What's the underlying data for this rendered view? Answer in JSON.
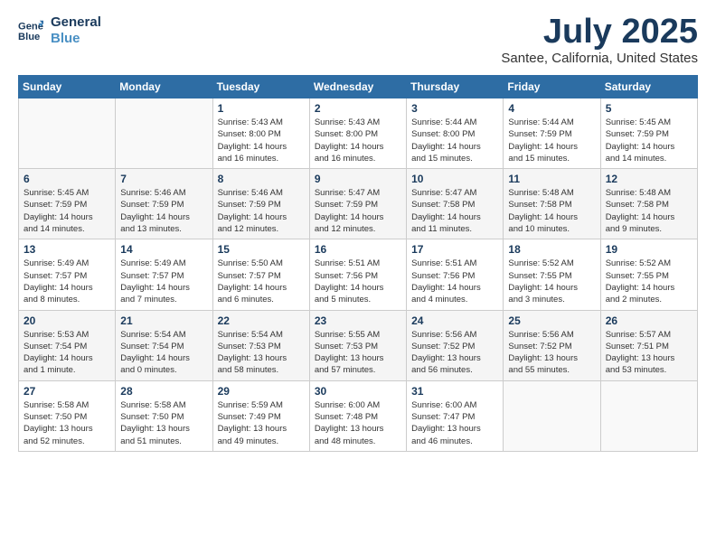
{
  "logo": {
    "line1": "General",
    "line2": "Blue"
  },
  "title": "July 2025",
  "location": "Santee, California, United States",
  "weekdays": [
    "Sunday",
    "Monday",
    "Tuesday",
    "Wednesday",
    "Thursday",
    "Friday",
    "Saturday"
  ],
  "weeks": [
    [
      {
        "day": "",
        "info": ""
      },
      {
        "day": "",
        "info": ""
      },
      {
        "day": "1",
        "info": "Sunrise: 5:43 AM\nSunset: 8:00 PM\nDaylight: 14 hours\nand 16 minutes."
      },
      {
        "day": "2",
        "info": "Sunrise: 5:43 AM\nSunset: 8:00 PM\nDaylight: 14 hours\nand 16 minutes."
      },
      {
        "day": "3",
        "info": "Sunrise: 5:44 AM\nSunset: 8:00 PM\nDaylight: 14 hours\nand 15 minutes."
      },
      {
        "day": "4",
        "info": "Sunrise: 5:44 AM\nSunset: 7:59 PM\nDaylight: 14 hours\nand 15 minutes."
      },
      {
        "day": "5",
        "info": "Sunrise: 5:45 AM\nSunset: 7:59 PM\nDaylight: 14 hours\nand 14 minutes."
      }
    ],
    [
      {
        "day": "6",
        "info": "Sunrise: 5:45 AM\nSunset: 7:59 PM\nDaylight: 14 hours\nand 14 minutes."
      },
      {
        "day": "7",
        "info": "Sunrise: 5:46 AM\nSunset: 7:59 PM\nDaylight: 14 hours\nand 13 minutes."
      },
      {
        "day": "8",
        "info": "Sunrise: 5:46 AM\nSunset: 7:59 PM\nDaylight: 14 hours\nand 12 minutes."
      },
      {
        "day": "9",
        "info": "Sunrise: 5:47 AM\nSunset: 7:59 PM\nDaylight: 14 hours\nand 12 minutes."
      },
      {
        "day": "10",
        "info": "Sunrise: 5:47 AM\nSunset: 7:58 PM\nDaylight: 14 hours\nand 11 minutes."
      },
      {
        "day": "11",
        "info": "Sunrise: 5:48 AM\nSunset: 7:58 PM\nDaylight: 14 hours\nand 10 minutes."
      },
      {
        "day": "12",
        "info": "Sunrise: 5:48 AM\nSunset: 7:58 PM\nDaylight: 14 hours\nand 9 minutes."
      }
    ],
    [
      {
        "day": "13",
        "info": "Sunrise: 5:49 AM\nSunset: 7:57 PM\nDaylight: 14 hours\nand 8 minutes."
      },
      {
        "day": "14",
        "info": "Sunrise: 5:49 AM\nSunset: 7:57 PM\nDaylight: 14 hours\nand 7 minutes."
      },
      {
        "day": "15",
        "info": "Sunrise: 5:50 AM\nSunset: 7:57 PM\nDaylight: 14 hours\nand 6 minutes."
      },
      {
        "day": "16",
        "info": "Sunrise: 5:51 AM\nSunset: 7:56 PM\nDaylight: 14 hours\nand 5 minutes."
      },
      {
        "day": "17",
        "info": "Sunrise: 5:51 AM\nSunset: 7:56 PM\nDaylight: 14 hours\nand 4 minutes."
      },
      {
        "day": "18",
        "info": "Sunrise: 5:52 AM\nSunset: 7:55 PM\nDaylight: 14 hours\nand 3 minutes."
      },
      {
        "day": "19",
        "info": "Sunrise: 5:52 AM\nSunset: 7:55 PM\nDaylight: 14 hours\nand 2 minutes."
      }
    ],
    [
      {
        "day": "20",
        "info": "Sunrise: 5:53 AM\nSunset: 7:54 PM\nDaylight: 14 hours\nand 1 minute."
      },
      {
        "day": "21",
        "info": "Sunrise: 5:54 AM\nSunset: 7:54 PM\nDaylight: 14 hours\nand 0 minutes."
      },
      {
        "day": "22",
        "info": "Sunrise: 5:54 AM\nSunset: 7:53 PM\nDaylight: 13 hours\nand 58 minutes."
      },
      {
        "day": "23",
        "info": "Sunrise: 5:55 AM\nSunset: 7:53 PM\nDaylight: 13 hours\nand 57 minutes."
      },
      {
        "day": "24",
        "info": "Sunrise: 5:56 AM\nSunset: 7:52 PM\nDaylight: 13 hours\nand 56 minutes."
      },
      {
        "day": "25",
        "info": "Sunrise: 5:56 AM\nSunset: 7:52 PM\nDaylight: 13 hours\nand 55 minutes."
      },
      {
        "day": "26",
        "info": "Sunrise: 5:57 AM\nSunset: 7:51 PM\nDaylight: 13 hours\nand 53 minutes."
      }
    ],
    [
      {
        "day": "27",
        "info": "Sunrise: 5:58 AM\nSunset: 7:50 PM\nDaylight: 13 hours\nand 52 minutes."
      },
      {
        "day": "28",
        "info": "Sunrise: 5:58 AM\nSunset: 7:50 PM\nDaylight: 13 hours\nand 51 minutes."
      },
      {
        "day": "29",
        "info": "Sunrise: 5:59 AM\nSunset: 7:49 PM\nDaylight: 13 hours\nand 49 minutes."
      },
      {
        "day": "30",
        "info": "Sunrise: 6:00 AM\nSunset: 7:48 PM\nDaylight: 13 hours\nand 48 minutes."
      },
      {
        "day": "31",
        "info": "Sunrise: 6:00 AM\nSunset: 7:47 PM\nDaylight: 13 hours\nand 46 minutes."
      },
      {
        "day": "",
        "info": ""
      },
      {
        "day": "",
        "info": ""
      }
    ]
  ]
}
